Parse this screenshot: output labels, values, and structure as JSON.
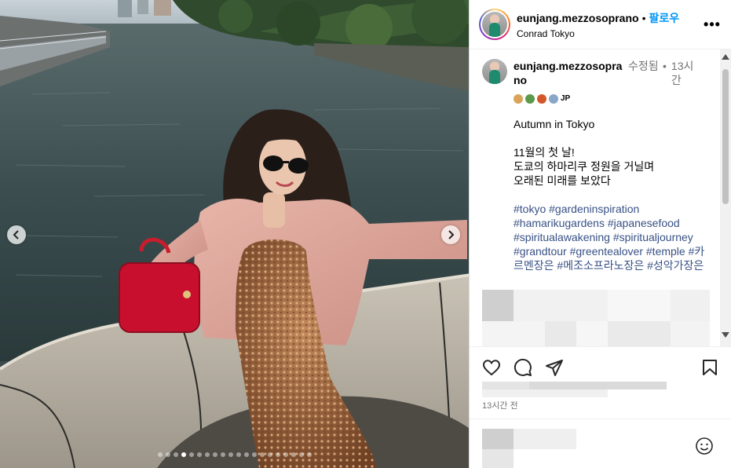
{
  "post": {
    "username": "eunjang.mezzosoprano",
    "separator": "•",
    "follow_label": "팔로우",
    "location": "Conrad Tokyo",
    "more_label": "•••"
  },
  "caption": {
    "username": "eunjang.mezzosoprano",
    "edited_label": "수정됨",
    "dot": "•",
    "time": "13시간",
    "emoji_suffix": "JP",
    "text": "Autumn in Tokyo\n\n11월의 첫 날!\n도쿄의 하마리쿠 정원을 거닐며\n오래된 미래를 보았다",
    "hashtags": "#tokyo #gardeninspiration #hamarikugardens #japanesefood #spiritualawakening #spiritualjourney #grandtour #greentealover #temple #카르멘장은 #메조소프라노장은 #성악가장은"
  },
  "footer": {
    "posted_ago": "13시간 전"
  },
  "icons": {
    "like": "heart-icon",
    "comment": "comment-icon",
    "share": "send-icon",
    "save": "bookmark-icon",
    "emoji": "emoji-icon",
    "prev": "chevron-left-icon",
    "next": "chevron-right-icon",
    "more": "more-icon"
  },
  "carousel": {
    "slide_count": 20,
    "active_index": 3
  },
  "colors": {
    "follow": "#0095f6",
    "hashtag": "#385185",
    "meta": "#737373"
  }
}
